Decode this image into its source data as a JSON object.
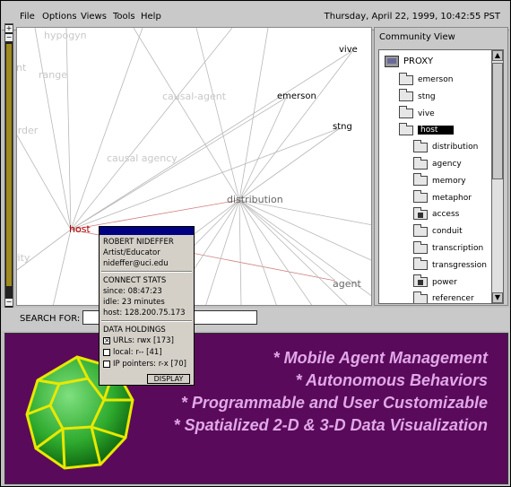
{
  "menubar": {
    "items": [
      "File",
      "Options",
      "Views",
      "Tools",
      "Help"
    ],
    "datetime": "Thursday, April 22, 1999, 10:42:55 PST"
  },
  "graph": {
    "ghost_labels": [
      "hypogyn",
      "int",
      "range",
      "causal-agent",
      "order",
      "causal agency",
      "rity"
    ],
    "nodes": {
      "vive": "vive",
      "emerson": "emerson",
      "stng": "stng",
      "distribution": "distribution",
      "host": "host",
      "agent": "agent"
    },
    "colors": {
      "host": "#b00000",
      "link": "#b8b8b8",
      "selected_link": "#d08080"
    }
  },
  "community": {
    "title": "Community View",
    "root": "PROXY",
    "items": [
      {
        "label": "emerson",
        "icon": "folder-icon"
      },
      {
        "label": "stng",
        "icon": "folder-icon"
      },
      {
        "label": "vive",
        "icon": "folder-icon"
      },
      {
        "label": "host",
        "icon": "folder-icon",
        "selected": true
      },
      {
        "label": "distribution",
        "icon": "folder-icon"
      },
      {
        "label": "agency",
        "icon": "folder-icon"
      },
      {
        "label": "memory",
        "icon": "folder-icon"
      },
      {
        "label": "metaphor",
        "icon": "folder-icon"
      },
      {
        "label": "access",
        "icon": "locked-folder-icon"
      },
      {
        "label": "conduit",
        "icon": "folder-icon"
      },
      {
        "label": "transcription",
        "icon": "folder-icon"
      },
      {
        "label": "transgression",
        "icon": "folder-icon"
      },
      {
        "label": "power",
        "icon": "locked-folder-icon"
      },
      {
        "label": "referencer",
        "icon": "folder-icon"
      }
    ]
  },
  "search": {
    "label": "SEARCH FOR:",
    "value": ""
  },
  "popup": {
    "name": "ROBERT NIDEFFER",
    "role": "Artist/Educator",
    "email": "nideffer@uci.edu",
    "connect_title": "CONNECT STATS",
    "since": "since: 08:47:23",
    "idle": "idle: 23 minutes",
    "host": "host: 128.200.75.173",
    "holdings_title": "DATA HOLDINGS",
    "holdings": [
      {
        "label": "URLs: rwx [173]",
        "checked": true
      },
      {
        "label": "local: r-- [41]",
        "checked": false
      },
      {
        "label": "IP pointers: r-x [70]",
        "checked": false
      }
    ],
    "display_button": "DISPLAY"
  },
  "banner": {
    "features": [
      "* Mobile Agent Management",
      "* Autonomous Behaviors",
      "* Programmable and User Customizable",
      "* Spatialized 2-D & 3-D Data Visualization"
    ],
    "colors": {
      "background": "#5a0a5a",
      "text": "#e0a8e8",
      "polyhedron": "#2eaa2e",
      "edges": "#e8e800"
    }
  }
}
